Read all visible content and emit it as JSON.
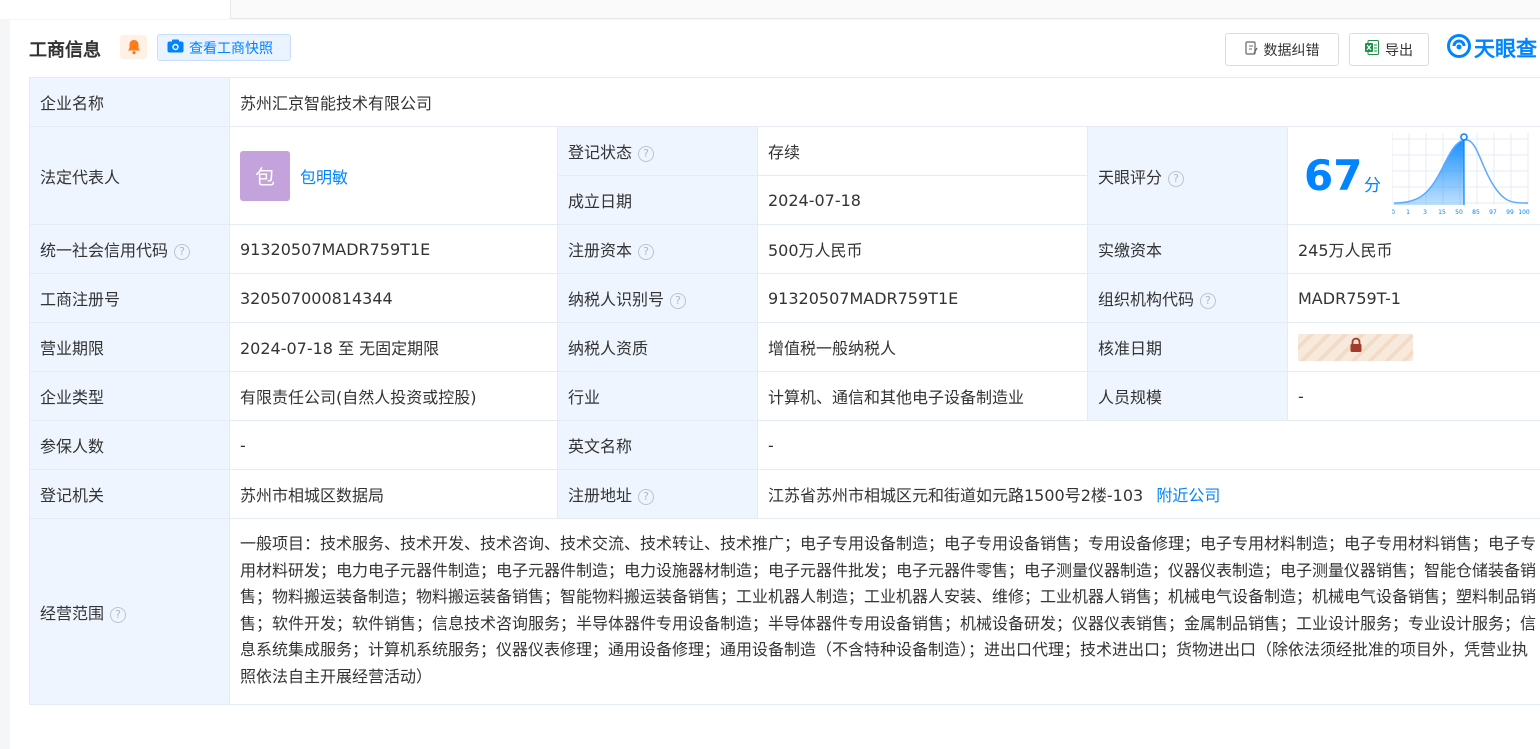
{
  "header": {
    "title": "工商信息",
    "snapshot_label": "查看工商快照",
    "correct_label": "数据纠错",
    "export_label": "导出",
    "logo_text": "天眼查"
  },
  "rows": {
    "company_name_label": "企业名称",
    "company_name": "苏州汇京智能技术有限公司",
    "legal_rep_label": "法定代表人",
    "legal_rep_avatar": "包",
    "legal_rep_name": "包明敏",
    "reg_status_label": "登记状态",
    "reg_status": "存续",
    "founded_label": "成立日期",
    "founded": "2024-07-18",
    "tianyan_score_label": "天眼评分",
    "credit_code_label": "统一社会信用代码",
    "credit_code": "91320507MADR759T1E",
    "reg_capital_label": "注册资本",
    "reg_capital": "500万人民币",
    "paid_capital_label": "实缴资本",
    "paid_capital": "245万人民币",
    "reg_no_label": "工商注册号",
    "reg_no": "320507000814344",
    "taxpayer_id_label": "纳税人识别号",
    "taxpayer_id": "91320507MADR759T1E",
    "org_code_label": "组织机构代码",
    "org_code": "MADR759T-1",
    "term_label": "营业期限",
    "term": "2024-07-18 至 无固定期限",
    "taxpayer_qual_label": "纳税人资质",
    "taxpayer_qual": "增值税一般纳税人",
    "approval_date_label": "核准日期",
    "type_label": "企业类型",
    "type": "有限责任公司(自然人投资或控股)",
    "industry_label": "行业",
    "industry": "计算机、通信和其他电子设备制造业",
    "staff_size_label": "人员规模",
    "staff_size": "-",
    "insured_label": "参保人数",
    "insured": "-",
    "english_name_label": "英文名称",
    "english_name": "-",
    "authority_label": "登记机关",
    "authority": "苏州市相城区数据局",
    "address_label": "注册地址",
    "address": "江苏省苏州市相城区元和街道如元路1500号2楼-103",
    "nearby_link": "附近公司",
    "scope_label": "经营范围",
    "scope": "一般项目：技术服务、技术开发、技术咨询、技术交流、技术转让、技术推广；电子专用设备制造；电子专用设备销售；专用设备修理；电子专用材料制造；电子专用材料销售；电子专用材料研发；电力电子元器件制造；电子元器件制造；电力设施器材制造；电子元器件批发；电子元器件零售；电子测量仪器制造；仪器仪表制造；电子测量仪器销售；智能仓储装备销售；物料搬运装备制造；物料搬运装备销售；智能物料搬运装备销售；工业机器人制造；工业机器人安装、维修；工业机器人销售；机械电气设备制造；机械电气设备销售；塑料制品销售；软件开发；软件销售；信息技术咨询服务；半导体器件专用设备制造；半导体器件专用设备销售；机械设备研发；仪器仪表销售；金属制品销售；工业设计服务；专业设计服务；信息系统集成服务；计算机系统服务；仪器仪表修理；通用设备修理；通用设备制造（不含特种设备制造）；进出口代理；技术进出口；货物进出口（除依法须经批准的项目外，凭营业执照依法自主开展经营活动）"
  },
  "score": {
    "value": "67",
    "unit": "分",
    "axis_ticks": [
      "0",
      "1",
      "3",
      "15",
      "50",
      "85",
      "97",
      "99",
      "100"
    ]
  },
  "colors": {
    "accent": "#0084ff",
    "status_green": "#2aa553",
    "label_bg": "#eef5fe",
    "avatar_bg": "#c4a3dc"
  },
  "icons": [
    "bell-icon",
    "camera-icon",
    "edit-icon",
    "excel-icon",
    "tianyancha-logo-icon",
    "help-icon",
    "lock-icon"
  ]
}
